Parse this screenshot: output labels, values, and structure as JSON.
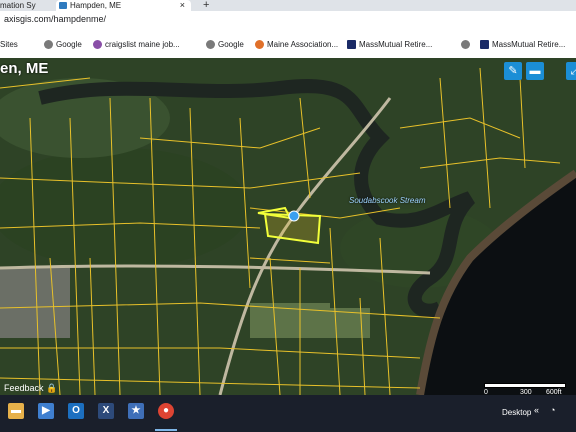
{
  "browser": {
    "tabs": [
      {
        "label": "mation Sy"
      },
      {
        "label": "Hampden, ME"
      }
    ],
    "new_tab": "+",
    "close": "×",
    "address": "axisgis.com/hampdenme/",
    "bookmarks": [
      {
        "label": "Sites",
        "icon": "apps-icon"
      },
      {
        "label": "Google",
        "icon": "google-icon"
      },
      {
        "label": "craigslist maine job...",
        "icon": "peace-icon"
      },
      {
        "label": "Google",
        "icon": "google-icon"
      },
      {
        "label": "Maine Association...",
        "icon": "org-icon"
      },
      {
        "label": "MassMutual Retire...",
        "icon": "massmutual-icon"
      },
      {
        "label": "MassMutual Retire...",
        "icon": "massmutual-icon"
      }
    ]
  },
  "map": {
    "title": "en, ME",
    "stream_label": "Soudabscook Stream",
    "feedback": "Feedback",
    "scale": {
      "zero": "0",
      "mid": "300",
      "end": "600ft"
    },
    "tools": [
      {
        "icon": "pencil-icon",
        "glyph": "✎"
      },
      {
        "icon": "layers-icon",
        "glyph": "▬"
      },
      {
        "icon": "expand-icon",
        "glyph": "⤢"
      }
    ]
  },
  "taskbar": {
    "desktop": "Desktop",
    "tray_chevron": "«",
    "icons": [
      {
        "name": "file-explorer-icon",
        "glyph": "▬",
        "color": "#e6b04a"
      },
      {
        "name": "media-player-icon",
        "glyph": "▶",
        "color": "#3f7fd0"
      },
      {
        "name": "outlook-icon",
        "glyph": "O",
        "color": "#1c6fc0"
      },
      {
        "name": "excel-icon",
        "glyph": "X",
        "color": "#2d4a7a"
      },
      {
        "name": "app-icon",
        "glyph": "★",
        "color": "#3f6fb8"
      },
      {
        "name": "chrome-icon",
        "glyph": "●",
        "color": "#dd4433"
      }
    ]
  }
}
